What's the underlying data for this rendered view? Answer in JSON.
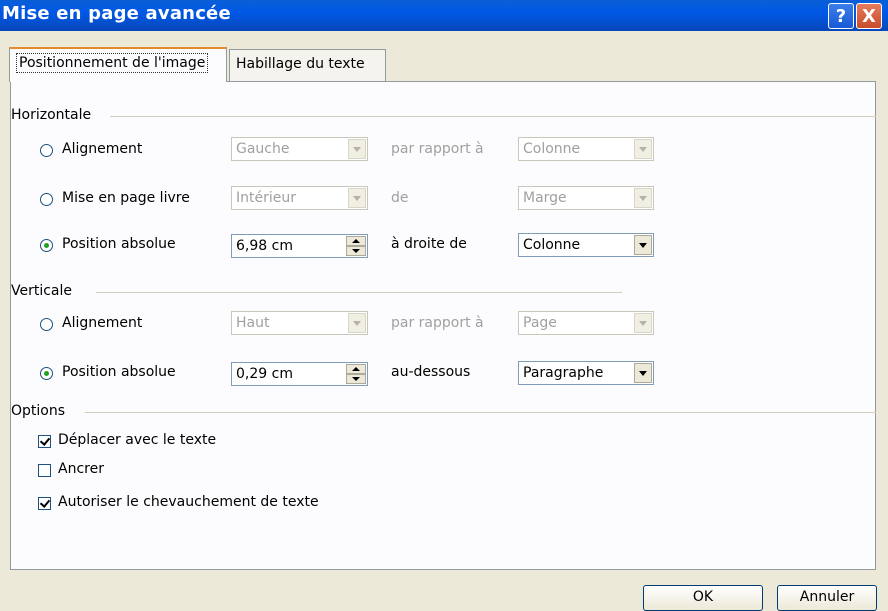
{
  "window": {
    "title": "Mise en page avancée",
    "help_label": "?",
    "close_label": "X"
  },
  "tabs": [
    "Positionnement de l'image",
    "Habillage du texte"
  ],
  "horizontal": {
    "header": "Horizontale",
    "rows": [
      {
        "option": "Alignement",
        "selected": false,
        "value": "Gauche",
        "relation": "par rapport à",
        "reference": "Colonne",
        "enabled": false
      },
      {
        "option": "Mise en page livre",
        "selected": false,
        "value": "Intérieur",
        "relation": "de",
        "reference": "Marge",
        "enabled": false
      },
      {
        "option": "Position absolue",
        "selected": true,
        "value": "6,98 cm",
        "relation": "à droite de",
        "reference": "Colonne",
        "enabled": true
      }
    ]
  },
  "vertical": {
    "header": "Verticale",
    "rows": [
      {
        "option": "Alignement",
        "selected": false,
        "value": "Haut",
        "relation": "par rapport à",
        "reference": "Page",
        "enabled": false
      },
      {
        "option": "Position absolue",
        "selected": true,
        "value": "0,29 cm",
        "relation": "au-dessous",
        "reference": "Paragraphe",
        "enabled": true
      }
    ]
  },
  "options": {
    "header": "Options",
    "items": [
      {
        "label": "Déplacer avec le texte",
        "checked": true
      },
      {
        "label": "Ancrer",
        "checked": false
      },
      {
        "label": "Autoriser le chevauchement de texte",
        "checked": true
      }
    ]
  },
  "buttons": {
    "ok": "OK",
    "cancel": "Annuler"
  }
}
